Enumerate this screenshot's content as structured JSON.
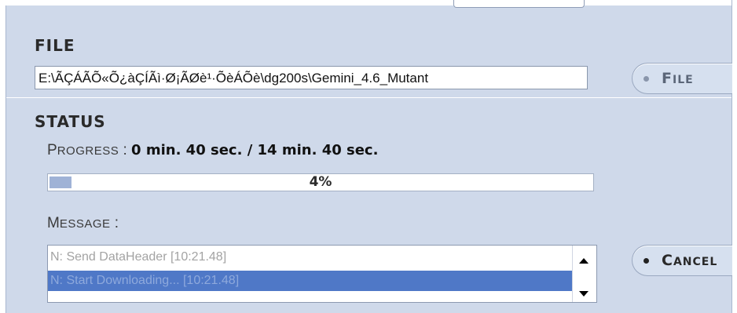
{
  "top_tab": {
    "label": "none"
  },
  "file_section": {
    "title": "FILE",
    "path": "E:\\ÃÇÁÃÕ«Õ¿àÇÍÃì·Ø¡ÃØè¹·ÕèÁÕè\\dg200s\\Gemini_4.6_Mutant",
    "button": {
      "first": "F",
      "rest": "ILE"
    }
  },
  "status_section": {
    "title": "STATUS",
    "progress_label": {
      "first": "P",
      "rest": "ROGRESS",
      "suffix": " :"
    },
    "progress_value": "0 min. 40 sec. / 14 min. 40 sec.",
    "progress_percent_text": "4%",
    "progress_fraction": 0.04,
    "message_label": {
      "first": "M",
      "rest": "ESSAGE",
      "suffix": " :"
    },
    "messages": [
      "N: Send DataHeader [10:21.48]",
      "N: Start Downloading... [10:21.48]"
    ],
    "cancel_button": {
      "first": "C",
      "rest": "ANCEL"
    }
  },
  "colors": {
    "panel": "#cfd9ea",
    "progress_fill": "#9fb2d6",
    "selection": "#4f78c7",
    "file_dot": "#8a96ab",
    "cancel_dot": "#222222"
  },
  "icons": {
    "scroll_up": "triangle-up",
    "scroll_down": "triangle-down",
    "button_bullet": "dot"
  }
}
